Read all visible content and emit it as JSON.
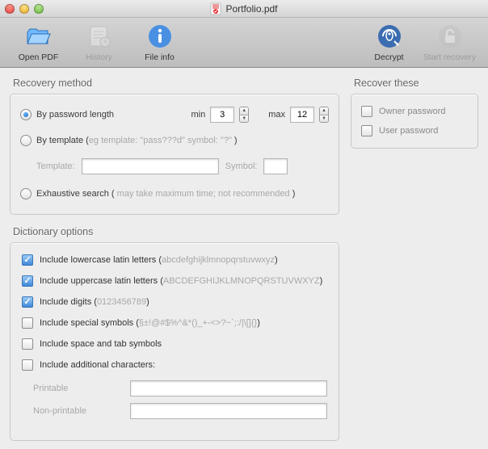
{
  "titlebar": {
    "title": "Portfolio.pdf"
  },
  "toolbar": {
    "open_pdf": "Open PDF",
    "history": "History",
    "file_info": "File info",
    "decrypt": "Decrypt",
    "start_recovery": "Start recovery"
  },
  "recovery": {
    "heading": "Recovery method",
    "by_password_length": "By password length",
    "min_label": "min",
    "min_value": "3",
    "max_label": "max",
    "max_value": "12",
    "by_template": "By template (",
    "by_template_hint": "eg template: \"pass???d\" symbol: \"?\"",
    "close_paren": " )",
    "template_label": "Template:",
    "template_value": "",
    "symbol_label": "Symbol:",
    "symbol_value": "",
    "exhaustive": "Exhaustive search (",
    "exhaustive_hint": " may take maximum time; not recommended ",
    "exhaustive_close": ")"
  },
  "recover_these": {
    "heading": "Recover these",
    "owner_password": "Owner password",
    "user_password": "User password"
  },
  "dictionary": {
    "heading": "Dictionary options",
    "lowercase_label": "Include lowercase latin letters (",
    "lowercase_hint": "abcdefghijklmnopqrstuvwxyz",
    "uppercase_label": "Include uppercase latin letters (",
    "uppercase_hint": "ABCDEFGHIJKLMNOPQRSTUVWXYZ",
    "digits_label": "Include digits (",
    "digits_hint": "0123456789",
    "special_label": "Include special symbols (",
    "special_hint": "§±!@#$%^&*()_+-<>?~`;:/|\\[]{}",
    "close": ")",
    "space_tab": "Include space and tab symbols",
    "additional": "Include additional characters:",
    "printable_label": "Printable",
    "printable_value": "",
    "nonprintable_label": "Non-printable",
    "nonprintable_value": ""
  }
}
